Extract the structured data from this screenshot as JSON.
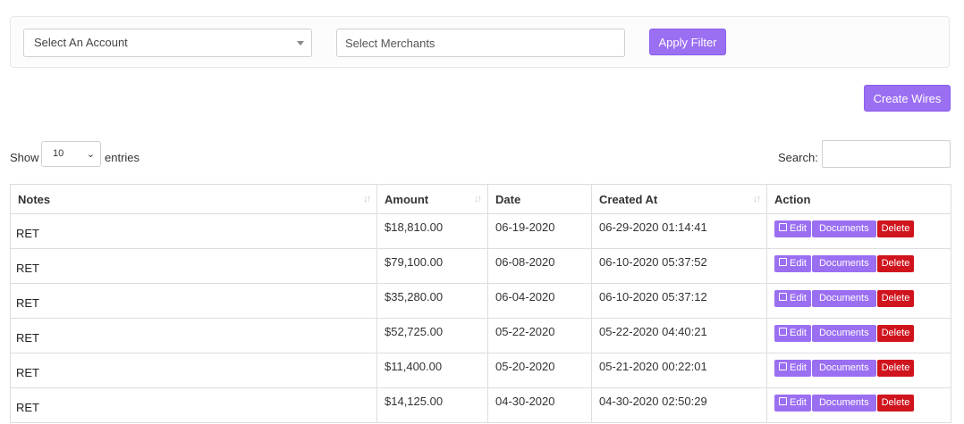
{
  "filters": {
    "account_placeholder": "Select An Account",
    "merchant_placeholder": "Select Merchants",
    "apply_label": "Apply Filter"
  },
  "create_label": "Create Wires",
  "length": {
    "show": "Show",
    "value": "10",
    "entries": "entries"
  },
  "search": {
    "label": "Search:",
    "value": ""
  },
  "table": {
    "columns": [
      "Notes",
      "Amount",
      "Date",
      "Created At",
      "Action"
    ],
    "actions": {
      "edit": "Edit",
      "documents": "Documents",
      "delete": "Delete"
    },
    "rows": [
      {
        "notes": "RET",
        "amount": "$18,810.00",
        "date": "06-19-2020",
        "created_at": "06-29-2020 01:14:41"
      },
      {
        "notes": "RET",
        "amount": "$79,100.00",
        "date": "06-08-2020",
        "created_at": "06-10-2020 05:37:52"
      },
      {
        "notes": "RET",
        "amount": "$35,280.00",
        "date": "06-04-2020",
        "created_at": "06-10-2020 05:37:12"
      },
      {
        "notes": "RET",
        "amount": "$52,725.00",
        "date": "05-22-2020",
        "created_at": "05-22-2020 04:40:21"
      },
      {
        "notes": "RET",
        "amount": "$11,400.00",
        "date": "05-20-2020",
        "created_at": "05-21-2020 00:22:01"
      },
      {
        "notes": "RET",
        "amount": "$14,125.00",
        "date": "04-30-2020",
        "created_at": "04-30-2020 02:50:29"
      }
    ]
  }
}
